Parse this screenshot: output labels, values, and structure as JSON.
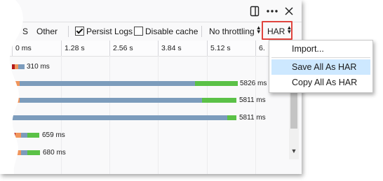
{
  "window": {
    "dock_icon": "dock-side-icon",
    "more_icon": "more-icon",
    "close_icon": "close-icon"
  },
  "toolbar": {
    "truncated_filter": "S",
    "other_label": "Other",
    "persist_logs_label": "Persist Logs",
    "persist_logs_checked": true,
    "disable_cache_label": "Disable cache",
    "disable_cache_checked": false,
    "throttling_label": "No throttling",
    "har_label": "HAR"
  },
  "timeline": {
    "ticks": [
      "0 ms",
      "1.28 s",
      "2.56 s",
      "3.84 s",
      "5.12 s",
      "6."
    ]
  },
  "requests": [
    {
      "duration_label": "310 ms"
    },
    {
      "duration_label": "5826 ms"
    },
    {
      "duration_label": "5811 ms"
    },
    {
      "duration_label": "5811 ms"
    },
    {
      "duration_label": "659 ms"
    },
    {
      "duration_label": "680 ms"
    }
  ],
  "har_menu": {
    "items": [
      {
        "label": "Import...",
        "active": false
      },
      {
        "label": "Save All As HAR",
        "active": true
      },
      {
        "label": "Copy All As HAR",
        "active": false
      }
    ]
  },
  "colors": {
    "blocked": "#b31a1a",
    "dns": "#f0955c",
    "waiting": "#7c9cbc",
    "receiving": "#5bc147",
    "highlight_border": "#e0443e",
    "menu_active": "#cde8ff"
  }
}
